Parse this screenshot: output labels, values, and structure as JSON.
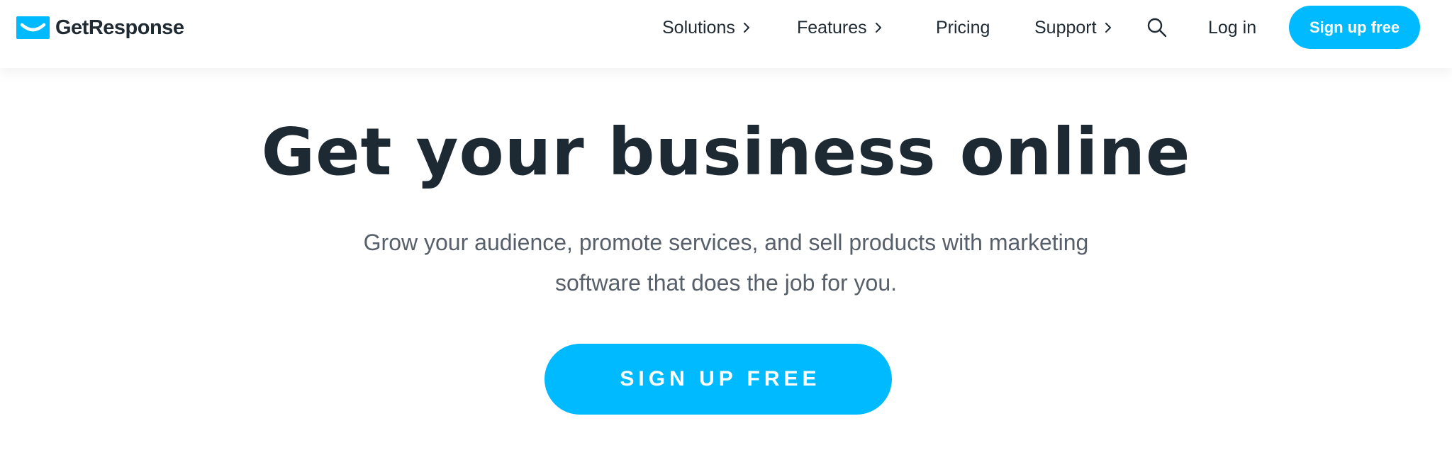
{
  "brand": {
    "name": "GetResponse",
    "color": "#00baff"
  },
  "nav": {
    "items": [
      {
        "label": "Solutions",
        "has_submenu": true
      },
      {
        "label": "Features",
        "has_submenu": true
      },
      {
        "label": "Pricing",
        "has_submenu": false
      },
      {
        "label": "Support",
        "has_submenu": true
      }
    ],
    "search_icon": "search-icon",
    "login_label": "Log in",
    "signup_label": "Sign up free"
  },
  "hero": {
    "title": "Get your business online",
    "subtitle": "Grow your audience, promote services, and sell products with marketing software that does the job for you.",
    "cta_label": "SIGN UP FREE"
  }
}
